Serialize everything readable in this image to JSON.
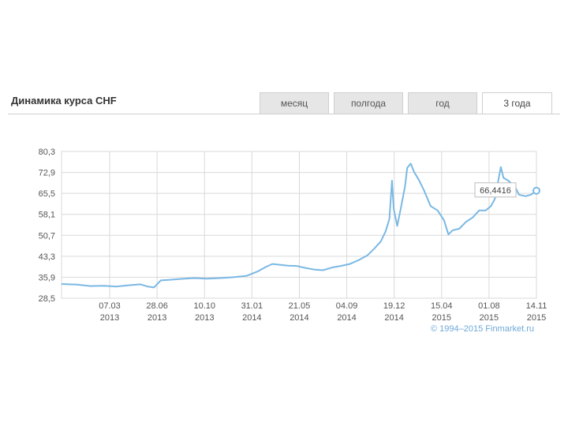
{
  "header": {
    "title": "Динамика курса CHF",
    "tabs": [
      {
        "label": "месяц",
        "active": false
      },
      {
        "label": "полгода",
        "active": false
      },
      {
        "label": "год",
        "active": false
      },
      {
        "label": "3 года",
        "active": true
      }
    ]
  },
  "copyright": "© 1994–2015 Finmarket.ru",
  "colors": {
    "line": "#7ab8e4",
    "grid": "#d9d9d9",
    "tab_bg": "#e6e6e6",
    "tab_active_bg": "#ffffff"
  },
  "chart_data": {
    "type": "line",
    "title": "",
    "xlabel": "",
    "ylabel": "",
    "yticks": [
      "80,3",
      "72,9",
      "65,5",
      "58,1",
      "50,7",
      "43,3",
      "35,9",
      "28,5"
    ],
    "ylim": [
      28.5,
      80.3
    ],
    "xticks": [
      {
        "date": "07.03",
        "year": "2013"
      },
      {
        "date": "28.06",
        "year": "2013"
      },
      {
        "date": "10.10",
        "year": "2013"
      },
      {
        "date": "31.01",
        "year": "2014"
      },
      {
        "date": "21.05",
        "year": "2014"
      },
      {
        "date": "04.09",
        "year": "2014"
      },
      {
        "date": "19.12",
        "year": "2014"
      },
      {
        "date": "15.04",
        "year": "2015"
      },
      {
        "date": "01.08",
        "year": "2015"
      },
      {
        "date": "14.11",
        "year": "2015"
      }
    ],
    "xlim": [
      "2012-11-14",
      "2015-11-14"
    ],
    "grid": true,
    "last_value_label": "66,4416",
    "series": [
      {
        "points": [
          [
            "2012-11-14",
            33.5
          ],
          [
            "2012-12-20",
            33.3
          ],
          [
            "2013-01-20",
            32.8
          ],
          [
            "2013-02-20",
            32.9
          ],
          [
            "2013-03-20",
            32.6
          ],
          [
            "2013-04-20",
            33.1
          ],
          [
            "2013-05-15",
            33.4
          ],
          [
            "2013-06-01",
            32.6
          ],
          [
            "2013-06-15",
            32.3
          ],
          [
            "2013-07-01",
            34.8
          ],
          [
            "2013-07-20",
            35.0
          ],
          [
            "2013-08-15",
            35.3
          ],
          [
            "2013-09-15",
            35.6
          ],
          [
            "2013-10-15",
            35.4
          ],
          [
            "2013-11-15",
            35.6
          ],
          [
            "2013-12-15",
            35.9
          ],
          [
            "2014-01-15",
            36.4
          ],
          [
            "2014-02-10",
            38.0
          ],
          [
            "2014-03-01",
            39.6
          ],
          [
            "2014-03-15",
            40.6
          ],
          [
            "2014-04-01",
            40.3
          ],
          [
            "2014-04-20",
            40.0
          ],
          [
            "2014-05-10",
            39.9
          ],
          [
            "2014-05-30",
            39.2
          ],
          [
            "2014-06-20",
            38.6
          ],
          [
            "2014-07-10",
            38.4
          ],
          [
            "2014-08-01",
            39.4
          ],
          [
            "2014-08-20",
            39.9
          ],
          [
            "2014-09-10",
            40.6
          ],
          [
            "2014-10-01",
            42.0
          ],
          [
            "2014-10-20",
            43.6
          ],
          [
            "2014-11-05",
            46.0
          ],
          [
            "2014-11-20",
            48.5
          ],
          [
            "2014-12-01",
            52.0
          ],
          [
            "2014-12-10",
            56.5
          ],
          [
            "2014-12-16",
            70.0
          ],
          [
            "2014-12-20",
            60.0
          ],
          [
            "2014-12-28",
            54.0
          ],
          [
            "2015-01-05",
            60.0
          ],
          [
            "2015-01-15",
            68.0
          ],
          [
            "2015-01-20",
            74.5
          ],
          [
            "2015-01-28",
            76.0
          ],
          [
            "2015-02-05",
            73.0
          ],
          [
            "2015-02-15",
            70.5
          ],
          [
            "2015-02-28",
            66.5
          ],
          [
            "2015-03-15",
            61.0
          ],
          [
            "2015-03-31",
            59.5
          ],
          [
            "2015-04-15",
            56.0
          ],
          [
            "2015-04-25",
            51.0
          ],
          [
            "2015-05-05",
            52.5
          ],
          [
            "2015-05-20",
            53.0
          ],
          [
            "2015-06-05",
            55.5
          ],
          [
            "2015-06-20",
            57.0
          ],
          [
            "2015-07-05",
            59.5
          ],
          [
            "2015-07-20",
            59.5
          ],
          [
            "2015-08-01",
            61.0
          ],
          [
            "2015-08-10",
            63.5
          ],
          [
            "2015-08-18",
            70.0
          ],
          [
            "2015-08-24",
            74.8
          ],
          [
            "2015-08-30",
            71.0
          ],
          [
            "2015-09-10",
            70.0
          ],
          [
            "2015-09-25",
            68.0
          ],
          [
            "2015-10-05",
            65.0
          ],
          [
            "2015-10-20",
            64.5
          ],
          [
            "2015-11-01",
            65.0
          ],
          [
            "2015-11-14",
            66.4416
          ]
        ]
      }
    ]
  }
}
